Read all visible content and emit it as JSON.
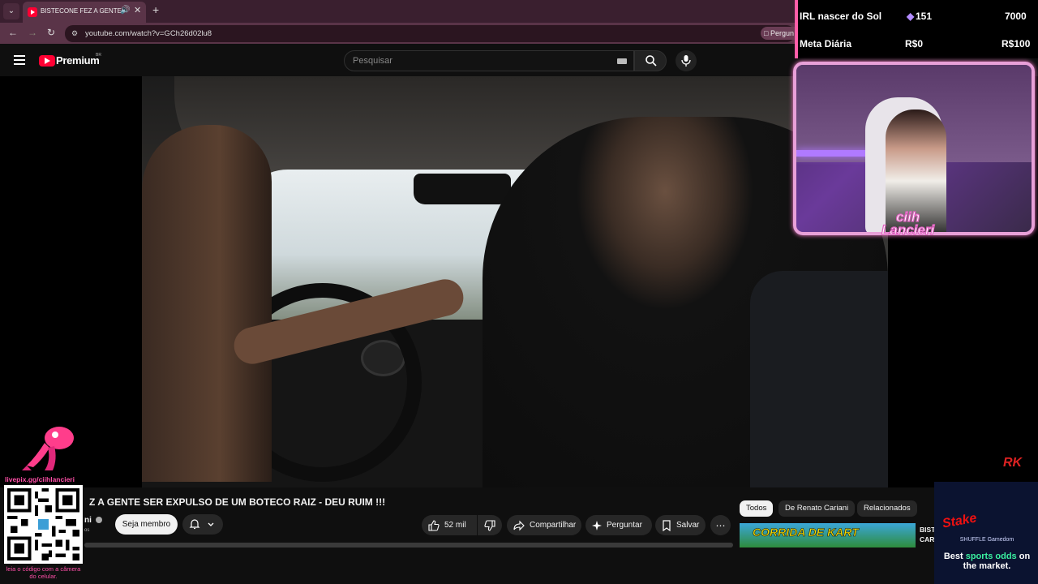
{
  "browser": {
    "tab_title": "BISTECONE FEZ A GENTE SER",
    "url": "youtube.com/watch?v=GCh26d02lu8",
    "ask_chip": "Pergun"
  },
  "header": {
    "brand": "Premium",
    "region": "BR",
    "search_placeholder": "Pesquisar"
  },
  "video": {
    "title": "Z A GENTE SER EXPULSO DE UM BOTECO RAIZ - DEU RUIM !!!",
    "channel": "ni",
    "subs": "os",
    "join_label": "Seja membro",
    "likes": "52 mil",
    "share_label": "Compartilhar",
    "ask_label": "Perguntar",
    "save_label": "Salvar",
    "more_label": "⋯",
    "watermark": "RK"
  },
  "sidebar": {
    "chips": [
      "Todos",
      "De Renato Cariani",
      "Relacionados"
    ],
    "rec_thumb_text": "CORRIDA DE KART",
    "rec_title": "BIST CAR"
  },
  "overlay": {
    "goal_rows": [
      {
        "label": "IRL nascer do Sol",
        "current": "151",
        "target": "7000"
      },
      {
        "label": "Meta Diária",
        "current": "R$0",
        "target": "R$100"
      }
    ],
    "streamer_name_1": "ciih",
    "streamer_name_2": "Lancieri",
    "pix_url": "livepix.gg/ciihlancieri",
    "qr_hint": "leia o código com a câmera do celular.",
    "ad_brand": "Stake",
    "ad_logos": "SHUFFLE  Gamedom",
    "ad_text_1": "Best ",
    "ad_text_highlight": "sports odds",
    "ad_text_2": " on the market."
  },
  "colors": {
    "accent_pink": "#ff5ea8",
    "youtube_red": "#ff0033"
  }
}
